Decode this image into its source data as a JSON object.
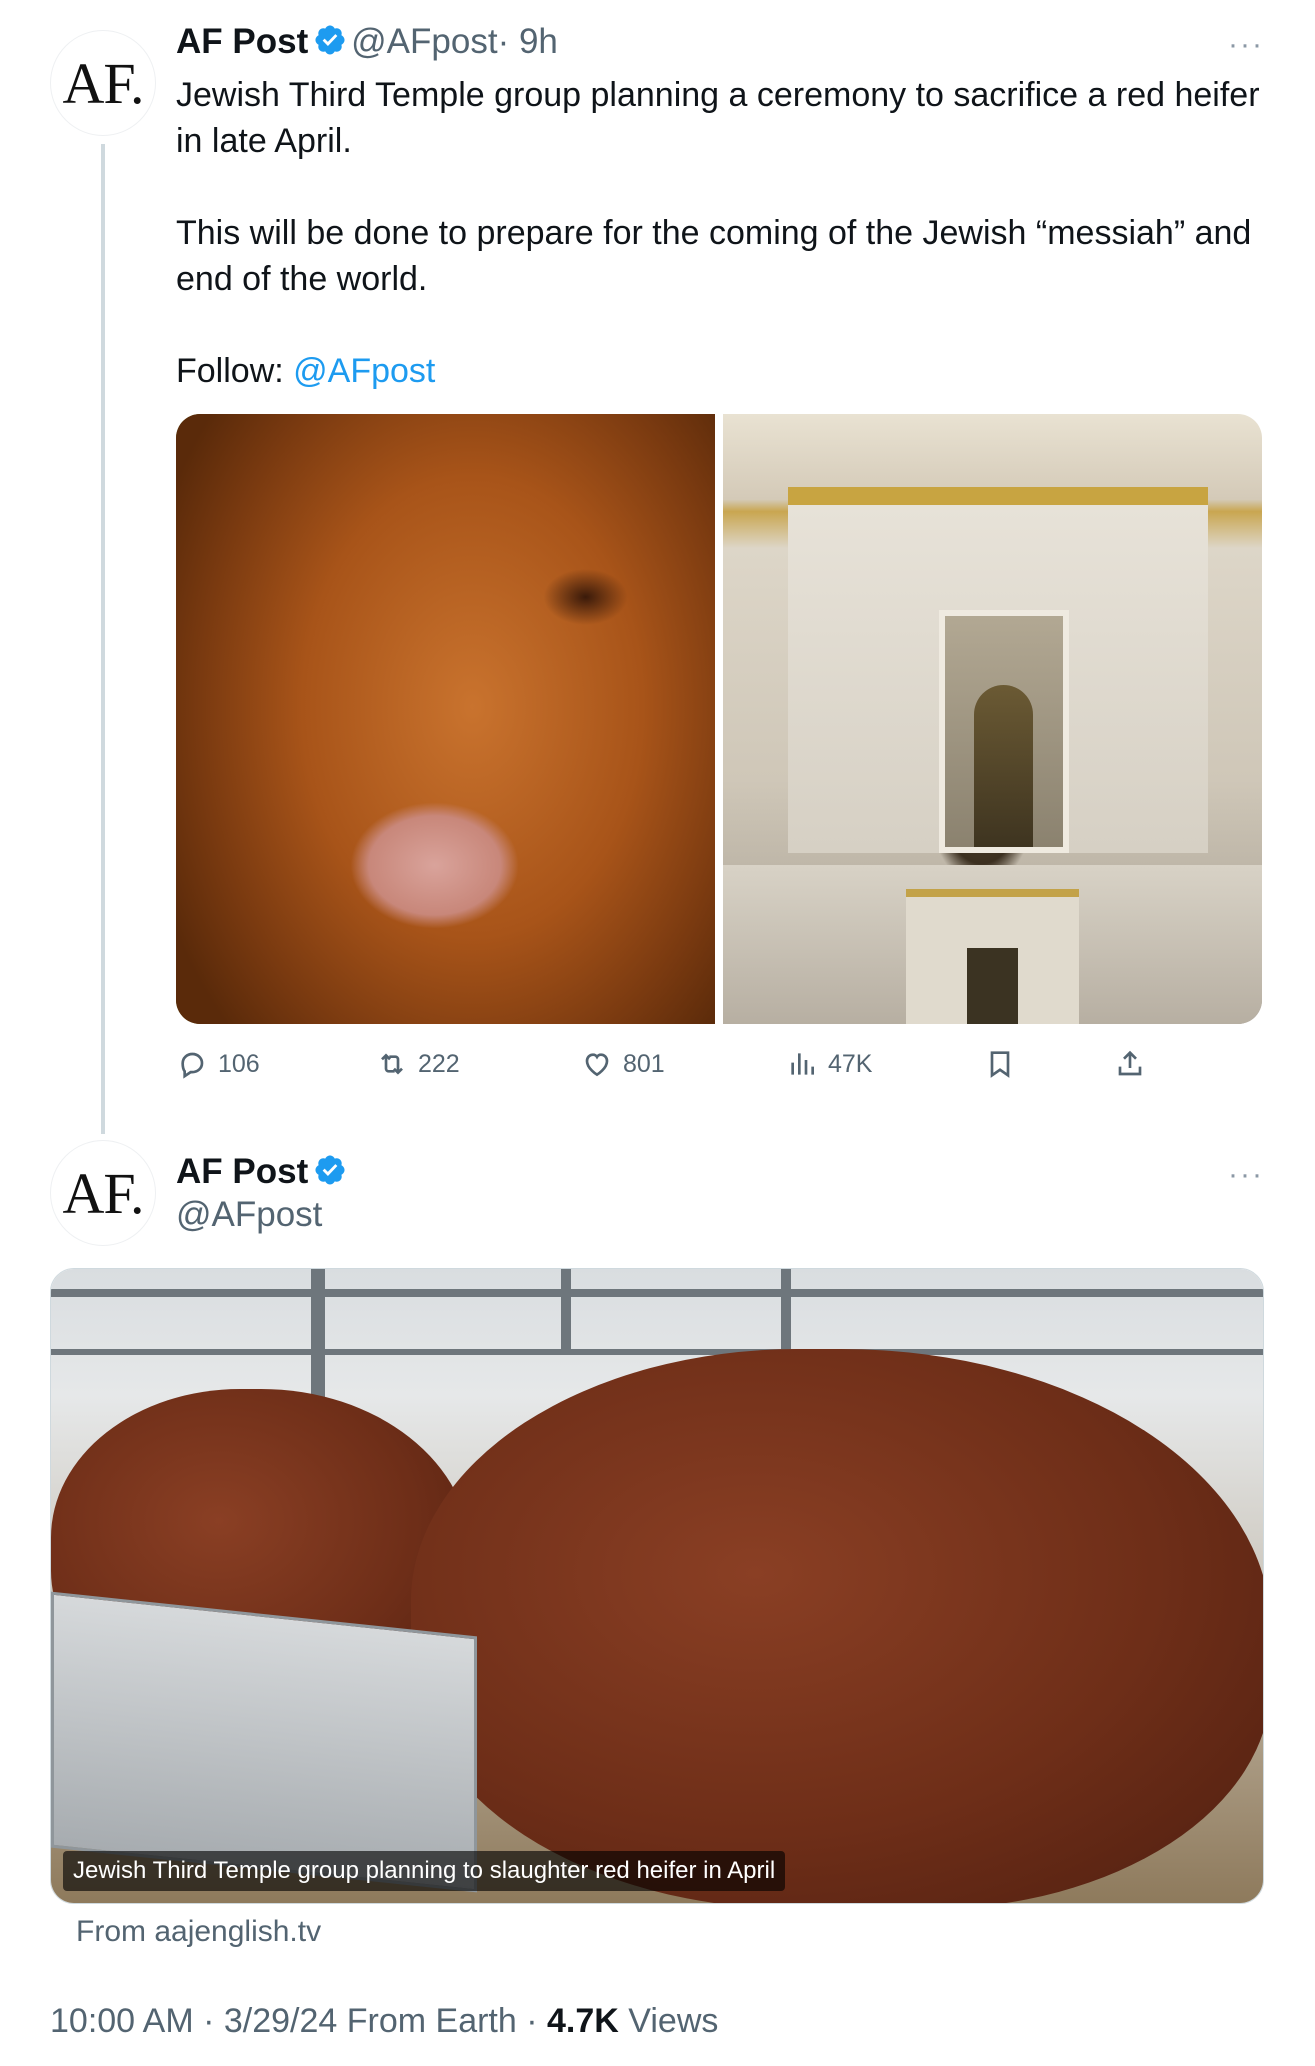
{
  "tweet1": {
    "avatar_text": "AF.",
    "name": "AF Post",
    "handle": "@AFpost",
    "time": "· 9h",
    "more": "···",
    "text_line1": "Jewish Third Temple group planning a ceremony to sacrifice a red heifer",
    "text_line2": "in late April.",
    "text_line3": "This will be done to prepare for the coming of the Jewish “messiah” and",
    "text_line4": "end of the world.",
    "follow_label": "Follow: ",
    "follow_link": "@AFpost",
    "actions": {
      "replies": "106",
      "retweets": "222",
      "likes": "801",
      "views": "47K"
    }
  },
  "tweet2": {
    "avatar_text": "AF.",
    "name": "AF Post",
    "handle": "@AFpost",
    "more": "···",
    "video_caption": "Jewish Third Temple group planning to slaughter red heifer in April",
    "source": "From aajenglish.tv"
  },
  "footer": {
    "time": "10:00 AM · 3/29/24 From Earth · ",
    "views_count": "4.7K",
    "views_label": " Views"
  },
  "colors": {
    "link": "#1d9bf0",
    "verified": "#1d9bf0",
    "muted": "#536471"
  }
}
